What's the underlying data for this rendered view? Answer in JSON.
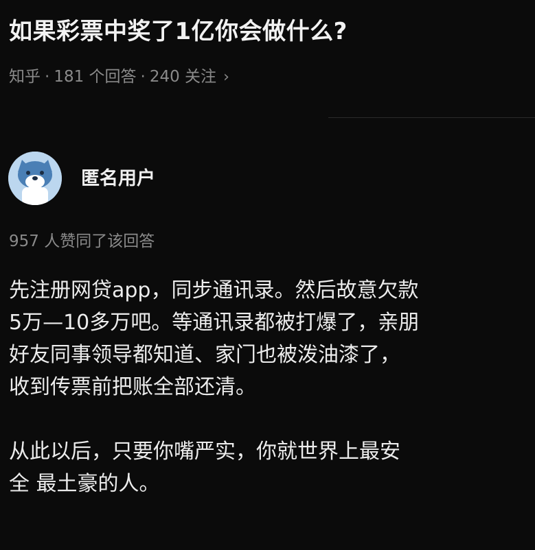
{
  "question": {
    "title": "如果彩票中奖了1亿你会做什么?"
  },
  "meta": {
    "source": "知乎",
    "answers": "181 个回答",
    "followers": "240 关注",
    "separator": "·",
    "chevron": "›"
  },
  "author": {
    "name": "匿名用户",
    "avatar_icon": "anonymous-avatar-icon"
  },
  "upvotes": "957 人赞同了该回答",
  "answer": {
    "lines": [
      "先注册网贷app，同步通讯录。然后故意欠款",
      "5万—10多万吧。等通讯录都被打爆了，亲朋",
      "好友同事领导都知道、家门也被泼油漆了，",
      "收到传票前把账全部还清。",
      "从此以后，只要你嘴严实，你就世界上最安",
      "全 最土豪的人。"
    ]
  },
  "colors": {
    "background": "#0b0b0b",
    "text": "#ececec",
    "muted": "#8a8a8a",
    "avatar": "#bcd7ef"
  }
}
